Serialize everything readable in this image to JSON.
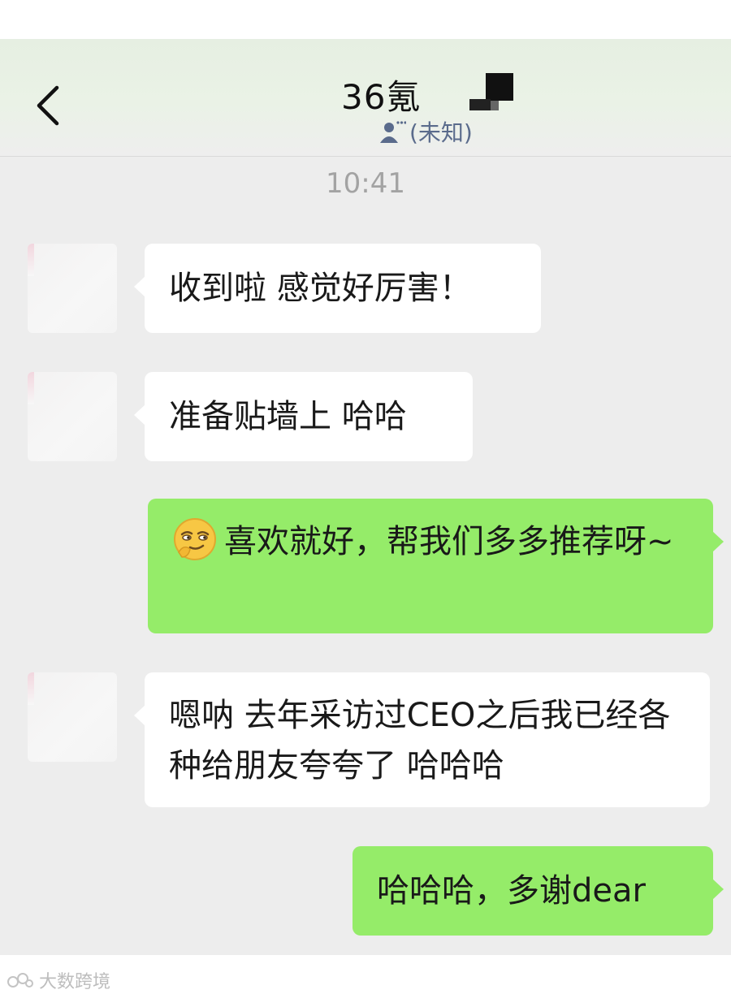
{
  "header": {
    "title": "36氪",
    "subtitle": "(未知)",
    "icons": {
      "back": "chevron-left-icon",
      "contact": "person-icon"
    }
  },
  "chat": {
    "timestamp": "10:41",
    "messages": [
      {
        "side": "in",
        "text": "收到啦 感觉好厉害！"
      },
      {
        "side": "in",
        "text": "准备贴墙上 哈哈"
      },
      {
        "side": "out",
        "emoji": "smirk-emoji-icon",
        "text": "喜欢就好，帮我们多多推荐呀~"
      },
      {
        "side": "in",
        "text": "嗯呐 去年采访过CEO之后我已经各种给朋友夸夸了 哈哈哈"
      },
      {
        "side": "out",
        "text": "哈哈哈，多谢dear"
      }
    ]
  },
  "watermark": {
    "text": "大数跨境"
  },
  "colors": {
    "background": "#ededed",
    "incoming_bubble": "#ffffff",
    "outgoing_bubble": "#95ec69",
    "timestamp": "#a3a3a3",
    "subtitle": "#5a6b8c"
  }
}
